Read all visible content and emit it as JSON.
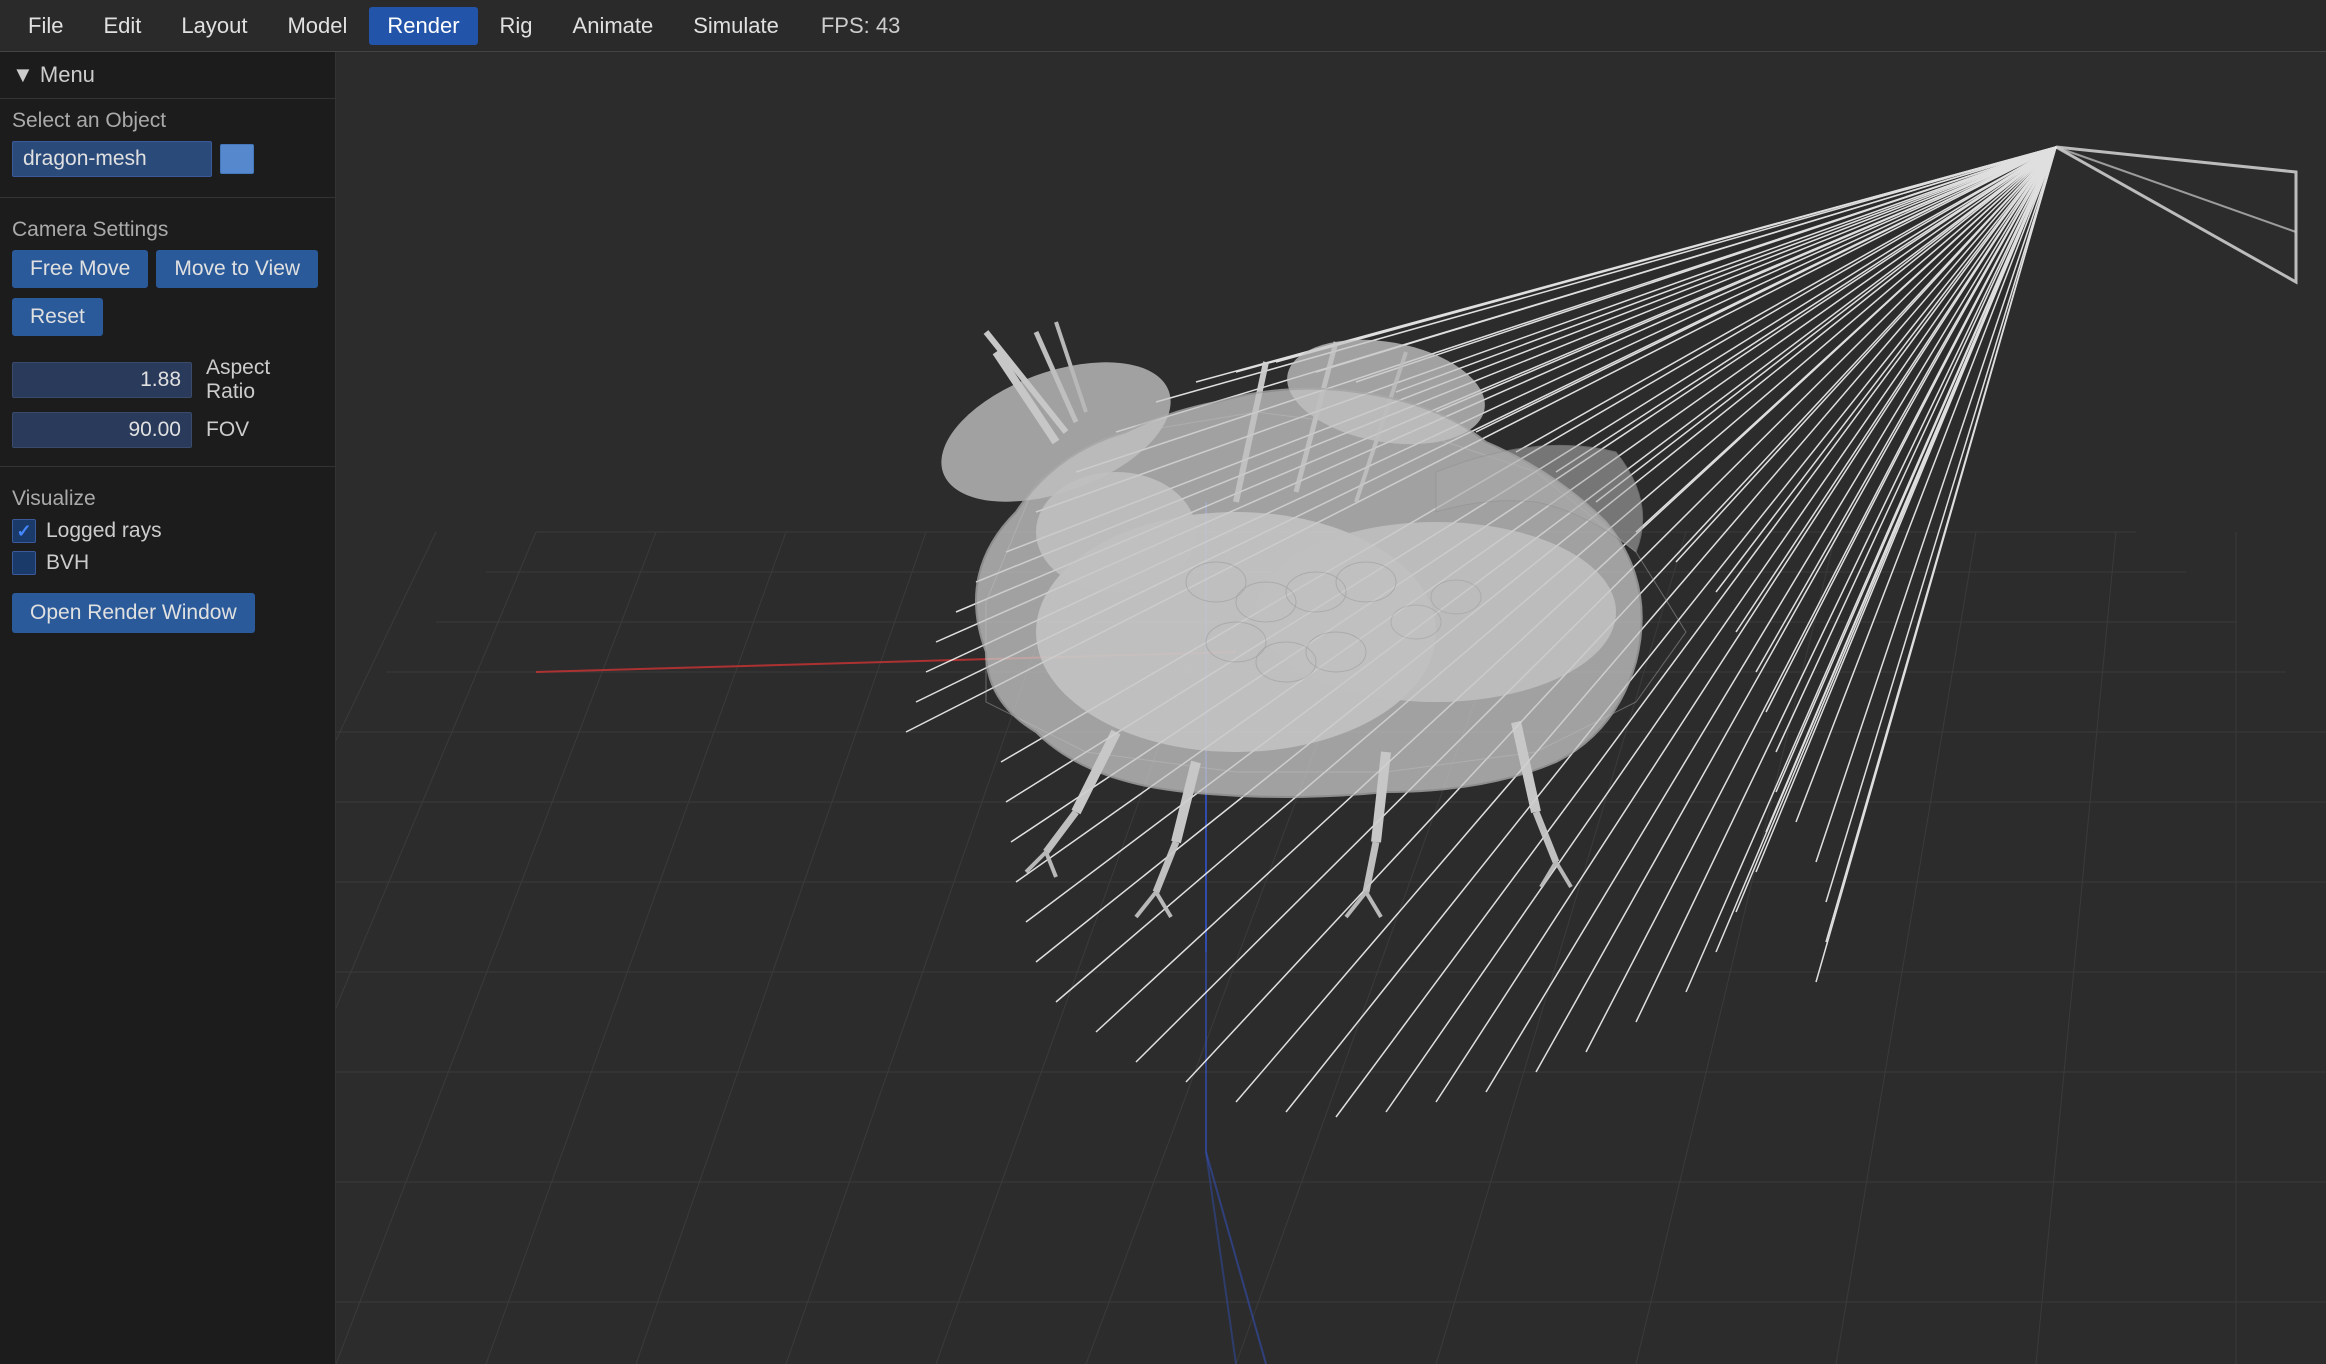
{
  "menubar": {
    "items": [
      {
        "label": "File",
        "active": false
      },
      {
        "label": "Edit",
        "active": false
      },
      {
        "label": "Layout",
        "active": false
      },
      {
        "label": "Model",
        "active": false
      },
      {
        "label": "Render",
        "active": true
      },
      {
        "label": "Rig",
        "active": false
      },
      {
        "label": "Animate",
        "active": false
      },
      {
        "label": "Simulate",
        "active": false
      }
    ],
    "fps": "FPS: 43"
  },
  "sidebar": {
    "menu_label": "▼ Menu",
    "select_label": "Select an Object",
    "object_name": "dragon-mesh",
    "camera_settings_label": "Camera Settings",
    "free_move_label": "Free Move",
    "move_to_view_label": "Move to View",
    "reset_label": "Reset",
    "aspect_ratio_value": "1.88",
    "aspect_ratio_label": "Aspect Ratio",
    "fov_value": "90.00",
    "fov_label": "FOV",
    "visualize_label": "Visualize",
    "logged_rays_label": "Logged rays",
    "logged_rays_checked": true,
    "bvh_label": "BVH",
    "bvh_checked": false,
    "render_window_label": "Open Render Window"
  },
  "colors": {
    "active_tab": "#2255aa",
    "button": "#2a5a9a",
    "sidebar_bg": "#1c1c1c",
    "viewport_bg": "#2a2a2a"
  }
}
